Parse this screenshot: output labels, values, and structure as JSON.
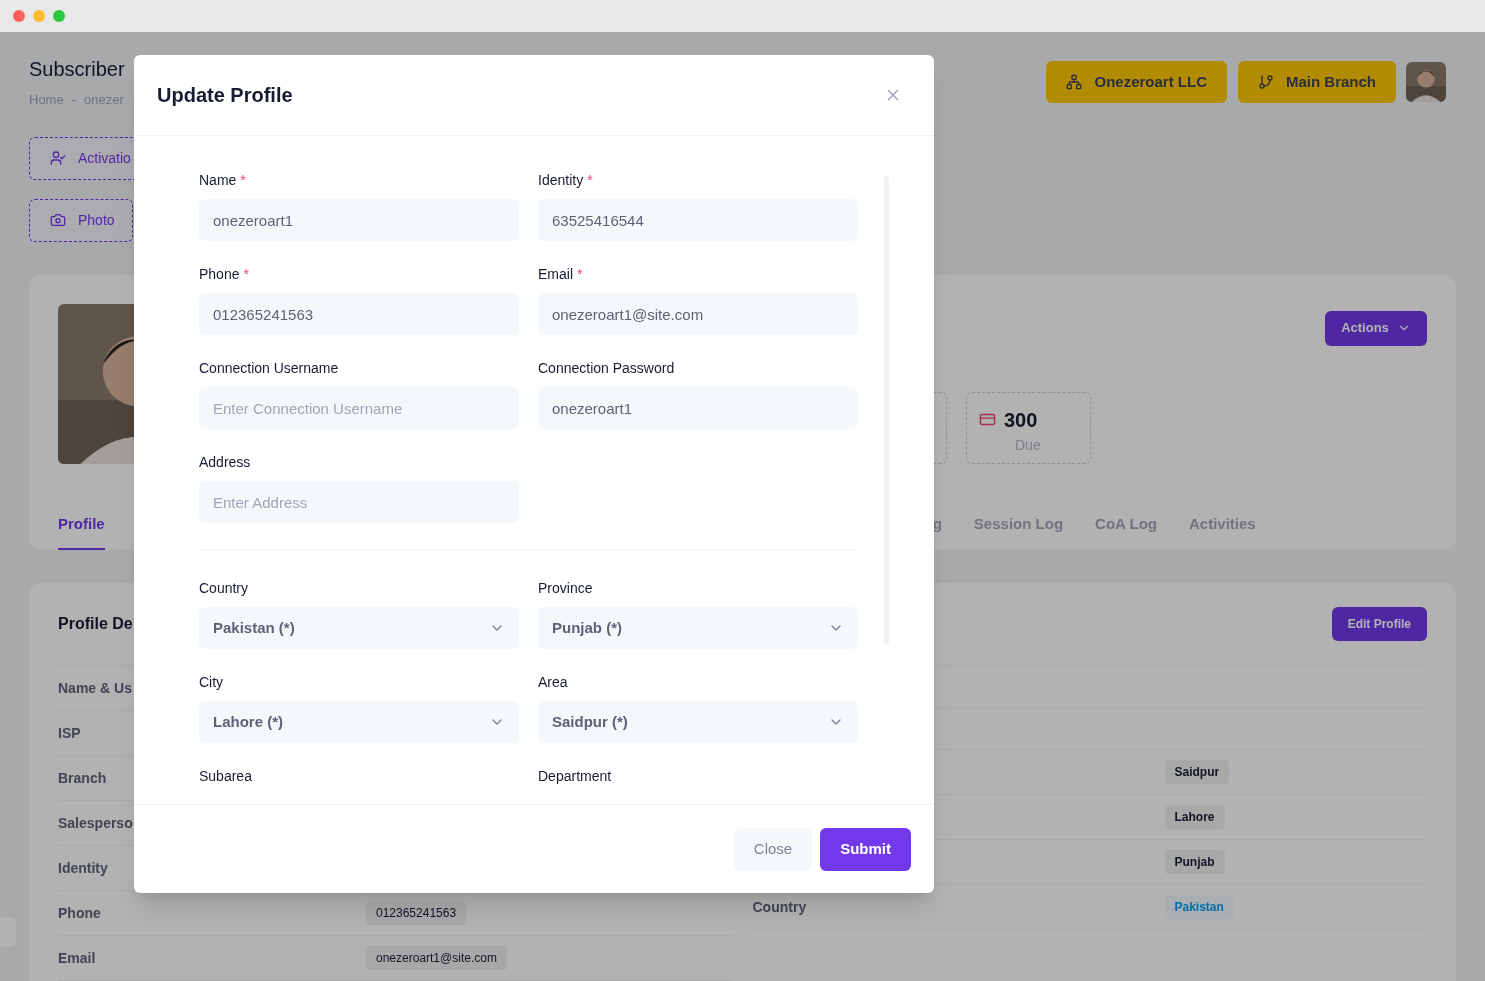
{
  "page": {
    "title": "Subscriber",
    "breadcrumb": {
      "home": "Home",
      "separator": "-",
      "current": "onezer"
    }
  },
  "side_buttons": [
    "Activatio",
    "Photo"
  ],
  "top_buttons": [
    "Onezeroart LLC",
    "Main Branch"
  ],
  "profile_card": {
    "actions": "Actions",
    "stat": {
      "value": "300",
      "label": "Due"
    },
    "tabs": [
      {
        "label": "Profile",
        "selected": true
      },
      {
        "label": "g",
        "selected": false
      },
      {
        "label": "Session Log",
        "selected": false
      },
      {
        "label": "CoA Log",
        "selected": false
      },
      {
        "label": "Activities",
        "selected": false
      }
    ]
  },
  "details_card": {
    "title": "Profile De",
    "edit": "Edit Profile",
    "left_rows": [
      {
        "label": "Name & Us"
      },
      {
        "label": "ISP"
      },
      {
        "label": "Branch"
      },
      {
        "label": "Salesperso"
      },
      {
        "label": "Identity"
      },
      {
        "label": "Phone",
        "value": "012365241563"
      },
      {
        "label": "Email",
        "value": "onezeroart1@site.com"
      }
    ],
    "right_rows": [
      {},
      {},
      {
        "value": "Saidpur",
        "kind": "plain"
      },
      {
        "value": "Lahore",
        "kind": "plain"
      },
      {
        "value": "Punjab",
        "kind": "plain"
      },
      {
        "label": "Country",
        "value": "Pakistan",
        "kind": "info"
      }
    ]
  },
  "modal": {
    "title": "Update Profile",
    "required_mark": "*",
    "sections": [
      {
        "fields": [
          {
            "kind": "text",
            "label": "Name",
            "required": true,
            "value": "onezeroart1"
          },
          {
            "kind": "text",
            "label": "Identity",
            "required": true,
            "value": "63525416544"
          },
          {
            "kind": "text",
            "label": "Phone",
            "required": true,
            "value": "012365241563"
          },
          {
            "kind": "text",
            "label": "Email",
            "required": true,
            "value": "onezeroart1@site.com"
          },
          {
            "kind": "text",
            "label": "Connection Username",
            "required": false,
            "placeholder": "Enter Connection Username"
          },
          {
            "kind": "text",
            "label": "Connection Password",
            "required": false,
            "value": "onezeroart1"
          },
          {
            "kind": "text",
            "label": "Address",
            "required": false,
            "placeholder": "Enter Address"
          }
        ]
      },
      {
        "fields": [
          {
            "kind": "select",
            "label": "Country",
            "required": false,
            "value": "Pakistan (*)"
          },
          {
            "kind": "select",
            "label": "Province",
            "required": false,
            "value": "Punjab (*)"
          },
          {
            "kind": "select",
            "label": "City",
            "required": false,
            "value": "Lahore (*)"
          },
          {
            "kind": "select",
            "label": "Area",
            "required": false,
            "value": "Saidpur (*)"
          },
          {
            "kind": "select",
            "label": "Subarea",
            "required": false
          },
          {
            "kind": "select",
            "label": "Department",
            "required": false
          }
        ]
      }
    ],
    "buttons": {
      "close": "Close",
      "submit": "Submit"
    }
  }
}
